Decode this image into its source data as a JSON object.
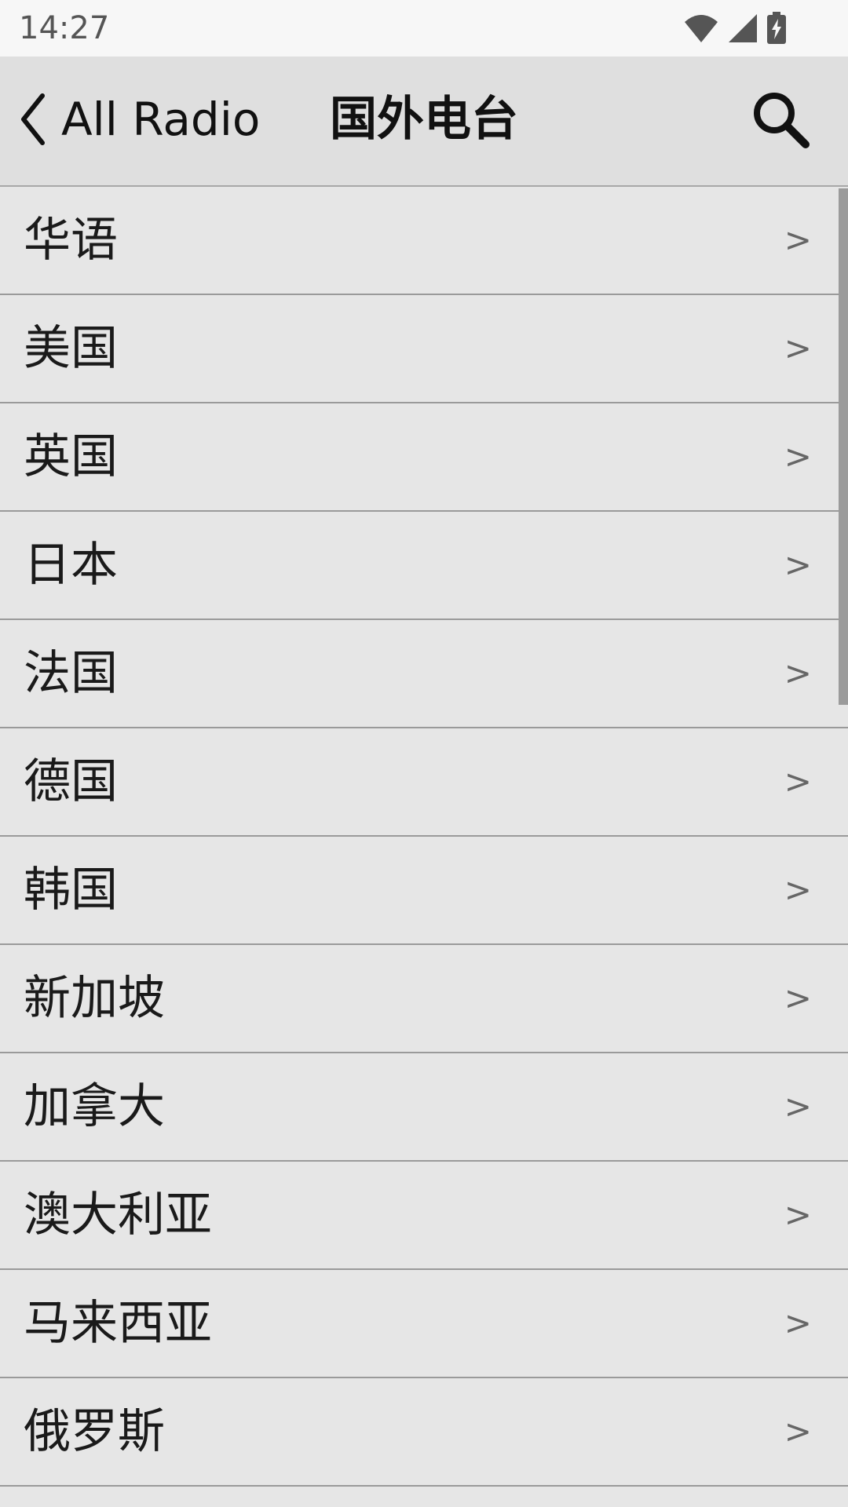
{
  "status_bar": {
    "time": "14:27",
    "icons": [
      "wifi-icon",
      "cell-signal-icon",
      "battery-charging-icon"
    ]
  },
  "navbar": {
    "back_label": "All Radio",
    "title": "国外电台",
    "search_icon": "search-icon"
  },
  "list": {
    "chevron": ">",
    "items": [
      {
        "label": "华语"
      },
      {
        "label": "美国"
      },
      {
        "label": "英国"
      },
      {
        "label": "日本"
      },
      {
        "label": "法国"
      },
      {
        "label": "德国"
      },
      {
        "label": "韩国"
      },
      {
        "label": "新加坡"
      },
      {
        "label": "加拿大"
      },
      {
        "label": "澳大利亚"
      },
      {
        "label": "马来西亚"
      },
      {
        "label": "俄罗斯"
      }
    ]
  },
  "colors": {
    "navbar_bg": "#dfdfdf",
    "list_bg": "#e6e6e6",
    "divider": "#9a9a9a",
    "status_bg": "#f7f7f7"
  }
}
